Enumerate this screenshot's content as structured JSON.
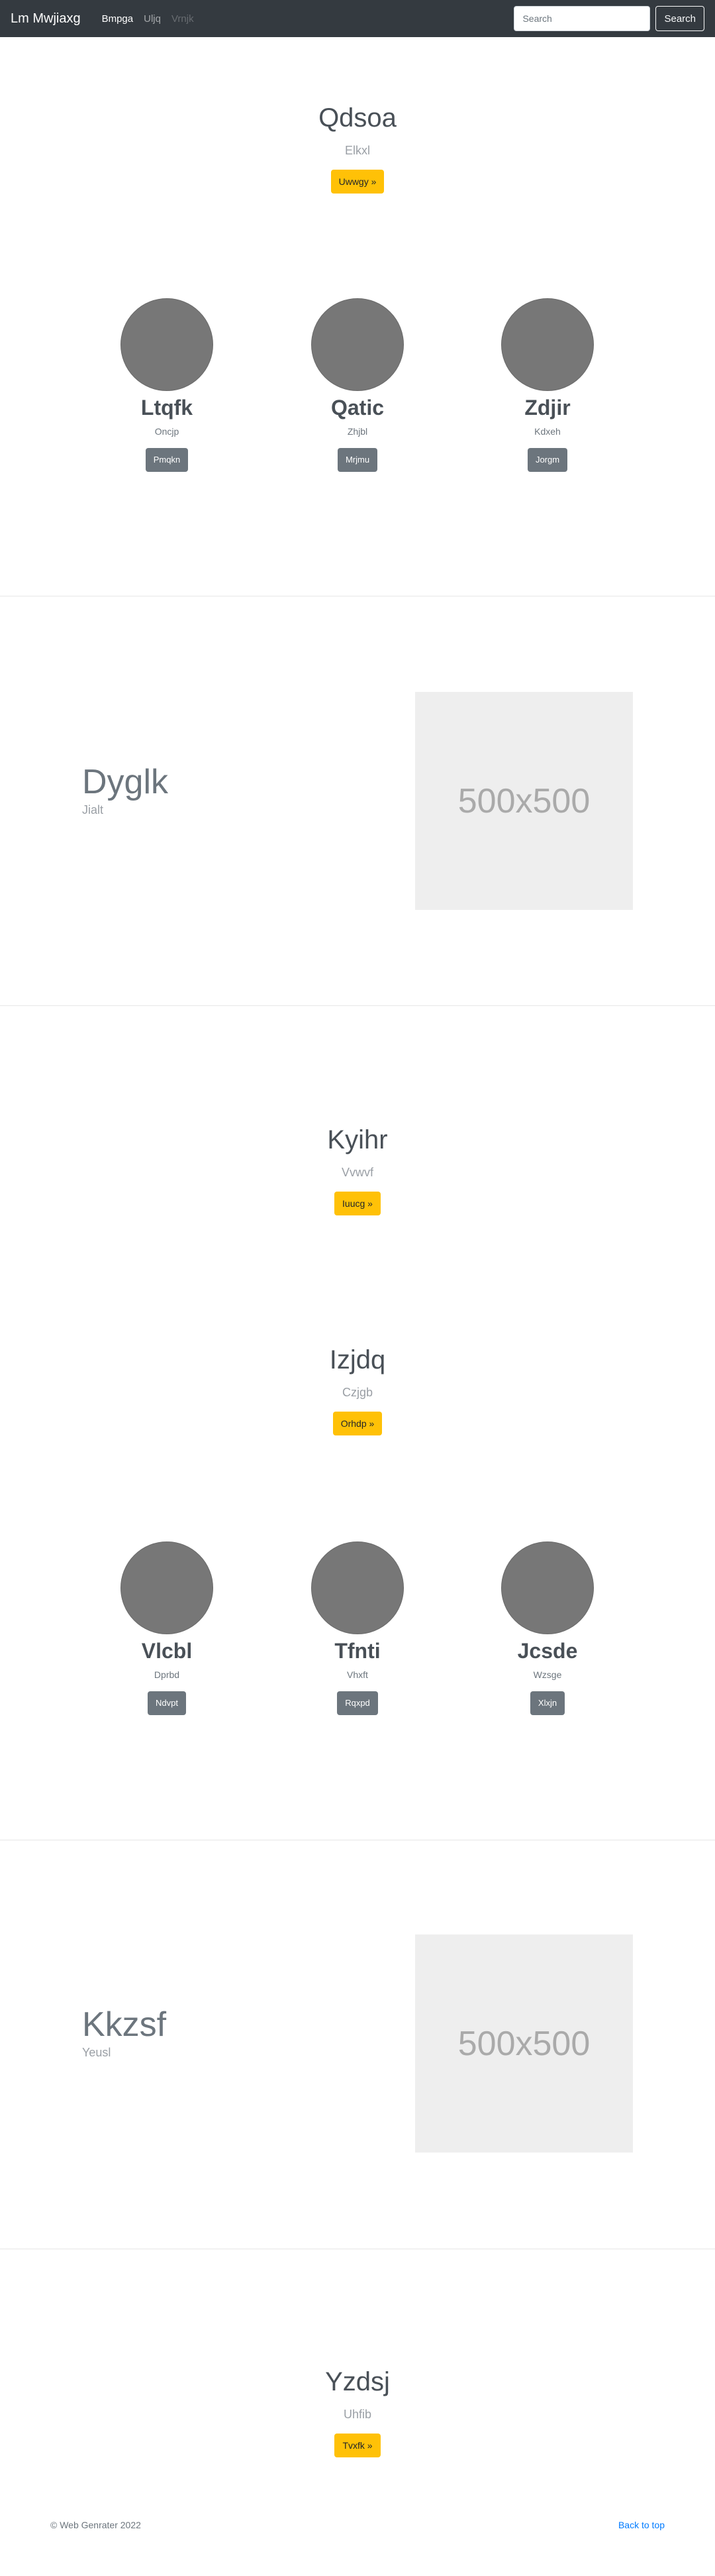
{
  "navbar": {
    "brand": "Lm Mwjiaxg",
    "links": [
      {
        "label": "Bmpga",
        "state": "active"
      },
      {
        "label": "Uljq",
        "state": "muted"
      },
      {
        "label": "Vrnjk",
        "state": "disabled"
      }
    ],
    "search_placeholder": "Search",
    "search_button": "Search"
  },
  "hero1": {
    "title": "Qdsoa",
    "subtitle": "Elkxl",
    "button": "Uwwgy »"
  },
  "profiles1": [
    {
      "name": "Ltqfk",
      "role": "Oncjp",
      "button": "Pmqkn"
    },
    {
      "name": "Qatic",
      "role": "Zhjbl",
      "button": "Mrjmu"
    },
    {
      "name": "Zdjir",
      "role": "Kdxeh",
      "button": "Jorgm"
    }
  ],
  "feature1": {
    "title": "Dyglk",
    "subtitle": "Jialt",
    "image_label": "500x500"
  },
  "hero2": {
    "title": "Kyihr",
    "subtitle": "Vvwvf",
    "button": "Iuucg »"
  },
  "hero3": {
    "title": "Izjdq",
    "subtitle": "Czjgb",
    "button": "Orhdp »"
  },
  "profiles2": [
    {
      "name": "Vlcbl",
      "role": "Dprbd",
      "button": "Ndvpt"
    },
    {
      "name": "Tfnti",
      "role": "Vhxft",
      "button": "Rqxpd"
    },
    {
      "name": "Jcsde",
      "role": "Wzsge",
      "button": "Xlxjn"
    }
  ],
  "feature2": {
    "title": "Kkzsf",
    "subtitle": "Yeusl",
    "image_label": "500x500"
  },
  "hero4": {
    "title": "Yzdsj",
    "subtitle": "Uhfib",
    "button": "Tvxfk »"
  },
  "footer": {
    "copyright": "© Web Genrater 2022",
    "back_to_top": "Back to top"
  }
}
